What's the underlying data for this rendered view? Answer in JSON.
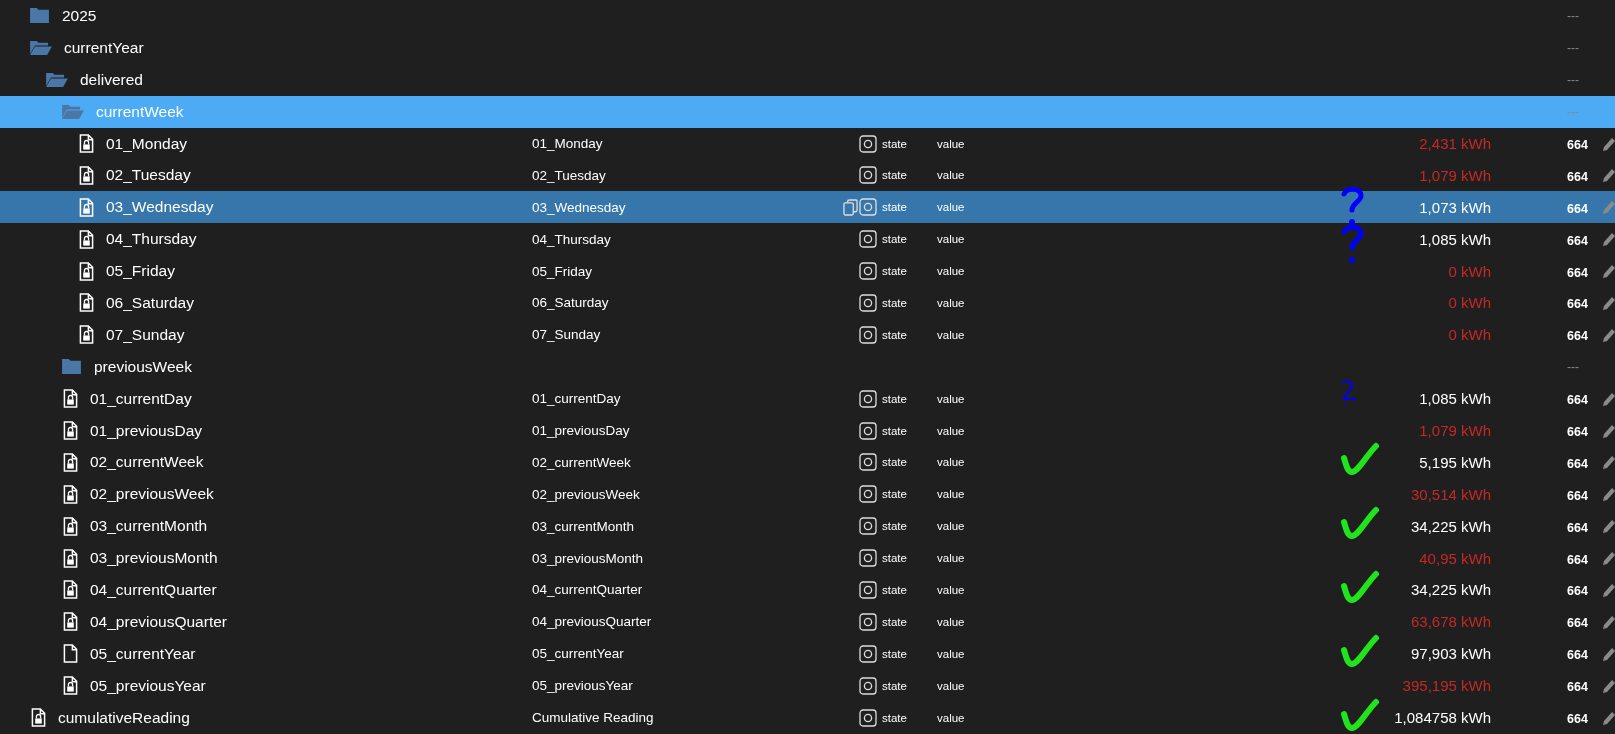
{
  "tree": [
    {
      "kind": "folder",
      "name": "2025",
      "expanded": false,
      "selected": false,
      "access": "---"
    },
    {
      "kind": "folder",
      "name": "currentYear",
      "expanded": true,
      "selected": false,
      "access": "---",
      "children": [
        {
          "kind": "folder",
          "name": "delivered",
          "expanded": true,
          "selected": false,
          "access": "---",
          "children": [
            {
              "kind": "folder",
              "name": "currentWeek",
              "expanded": true,
              "selected": true,
              "access": "---",
              "children": [
                {
                  "kind": "state",
                  "name": "01_Monday",
                  "title": "01_Monday",
                  "locked": true,
                  "type": "state",
                  "role": "value",
                  "value": "2,431 kWh",
                  "acknowledged": false,
                  "access": "664",
                  "selected": false,
                  "hovered": false
                },
                {
                  "kind": "state",
                  "name": "02_Tuesday",
                  "title": "02_Tuesday",
                  "locked": true,
                  "type": "state",
                  "role": "value",
                  "value": "1,079 kWh",
                  "acknowledged": false,
                  "access": "664",
                  "selected": false,
                  "hovered": false
                },
                {
                  "kind": "state",
                  "name": "03_Wednesday",
                  "title": "03_Wednesday",
                  "locked": true,
                  "type": "state",
                  "role": "value",
                  "value": "1,073 kWh",
                  "acknowledged": true,
                  "access": "664",
                  "selected": false,
                  "hovered": true,
                  "annotation": {
                    "kind": "question",
                    "color": "#0000ff"
                  }
                },
                {
                  "kind": "state",
                  "name": "04_Thursday",
                  "title": "04_Thursday",
                  "locked": true,
                  "type": "state",
                  "role": "value",
                  "value": "1,085 kWh",
                  "acknowledged": true,
                  "access": "664",
                  "selected": false,
                  "hovered": false,
                  "annotation": {
                    "kind": "question",
                    "color": "#0000ff"
                  }
                },
                {
                  "kind": "state",
                  "name": "05_Friday",
                  "title": "05_Friday",
                  "locked": true,
                  "type": "state",
                  "role": "value",
                  "value": "0 kWh",
                  "acknowledged": false,
                  "access": "664",
                  "selected": false,
                  "hovered": false
                },
                {
                  "kind": "state",
                  "name": "06_Saturday",
                  "title": "06_Saturday",
                  "locked": true,
                  "type": "state",
                  "role": "value",
                  "value": "0 kWh",
                  "acknowledged": false,
                  "access": "664",
                  "selected": false,
                  "hovered": false
                },
                {
                  "kind": "state",
                  "name": "07_Sunday",
                  "title": "07_Sunday",
                  "locked": true,
                  "type": "state",
                  "role": "value",
                  "value": "0 kWh",
                  "acknowledged": false,
                  "access": "664",
                  "selected": false,
                  "hovered": false
                }
              ]
            },
            {
              "kind": "folder",
              "name": "previousWeek",
              "expanded": false,
              "selected": false,
              "access": "---"
            },
            {
              "kind": "state",
              "name": "01_currentDay",
              "title": "01_currentDay",
              "locked": true,
              "type": "state",
              "role": "value",
              "value": "1,085 kWh",
              "acknowledged": true,
              "access": "664",
              "selected": false,
              "hovered": false,
              "annotation": {
                "kind": "scribble",
                "color": "#0000ff"
              }
            },
            {
              "kind": "state",
              "name": "01_previousDay",
              "title": "01_previousDay",
              "locked": true,
              "type": "state",
              "role": "value",
              "value": "1,079 kWh",
              "acknowledged": false,
              "access": "664",
              "selected": false,
              "hovered": false
            },
            {
              "kind": "state",
              "name": "02_currentWeek",
              "title": "02_currentWeek",
              "locked": true,
              "type": "state",
              "role": "value",
              "value": "5,195 kWh",
              "acknowledged": true,
              "access": "664",
              "selected": false,
              "hovered": false,
              "annotation": {
                "kind": "check",
                "color": "#22e41c"
              }
            },
            {
              "kind": "state",
              "name": "02_previousWeek",
              "title": "02_previousWeek",
              "locked": true,
              "type": "state",
              "role": "value",
              "value": "30,514 kWh",
              "acknowledged": false,
              "access": "664",
              "selected": false,
              "hovered": false
            },
            {
              "kind": "state",
              "name": "03_currentMonth",
              "title": "03_currentMonth",
              "locked": true,
              "type": "state",
              "role": "value",
              "value": "34,225 kWh",
              "acknowledged": true,
              "access": "664",
              "selected": false,
              "hovered": false,
              "annotation": {
                "kind": "check",
                "color": "#22e41c"
              }
            },
            {
              "kind": "state",
              "name": "03_previousMonth",
              "title": "03_previousMonth",
              "locked": true,
              "type": "state",
              "role": "value",
              "value": "40,95 kWh",
              "acknowledged": false,
              "access": "664",
              "selected": false,
              "hovered": false
            },
            {
              "kind": "state",
              "name": "04_currentQuarter",
              "title": "04_currentQuarter",
              "locked": true,
              "type": "state",
              "role": "value",
              "value": "34,225 kWh",
              "acknowledged": true,
              "access": "664",
              "selected": false,
              "hovered": false,
              "annotation": {
                "kind": "check",
                "color": "#22e41c"
              }
            },
            {
              "kind": "state",
              "name": "04_previousQuarter",
              "title": "04_previousQuarter",
              "locked": true,
              "type": "state",
              "role": "value",
              "value": "63,678 kWh",
              "acknowledged": false,
              "access": "664",
              "selected": false,
              "hovered": false
            },
            {
              "kind": "state",
              "name": "05_currentYear",
              "title": "05_currentYear",
              "locked": false,
              "type": "state",
              "role": "value",
              "value": "97,903 kWh",
              "acknowledged": true,
              "access": "664",
              "selected": false,
              "hovered": false,
              "annotation": {
                "kind": "check",
                "color": "#22e41c"
              }
            },
            {
              "kind": "state",
              "name": "05_previousYear",
              "title": "05_previousYear",
              "locked": true,
              "type": "state",
              "role": "value",
              "value": "395,195 kWh",
              "acknowledged": false,
              "access": "664",
              "selected": false,
              "hovered": false
            }
          ]
        }
      ]
    },
    {
      "kind": "state",
      "name": "cumulativeReading",
      "title": "Cumulative Reading",
      "locked": true,
      "type": "state",
      "role": "value",
      "value": "1,084758 kWh",
      "acknowledged": true,
      "access": "664",
      "selected": false,
      "hovered": false,
      "annotation": {
        "kind": "check",
        "color": "#22e41c"
      }
    }
  ]
}
